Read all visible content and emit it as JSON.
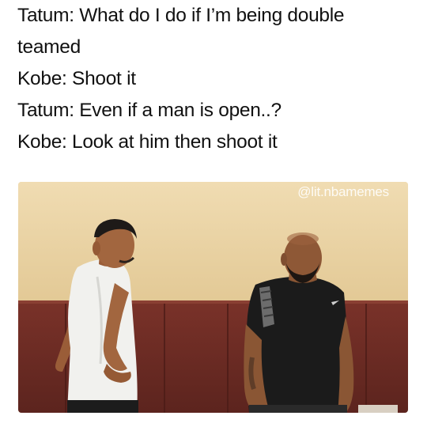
{
  "caption": {
    "lines": [
      "Tatum: What do I do if I’m being double",
      "teamed",
      "Kobe: Shoot it",
      "Tatum: Even if a man is open..?",
      "Kobe: Look at him then shoot it"
    ]
  },
  "photo": {
    "watermark": "@lit.nbamemes",
    "colors": {
      "wall": "#e9d4a8",
      "padding": "#6f2c25",
      "skin": "#a2663f",
      "white_shirt": "#f1f1ee",
      "black_shirt": "#1b1b1b"
    }
  }
}
